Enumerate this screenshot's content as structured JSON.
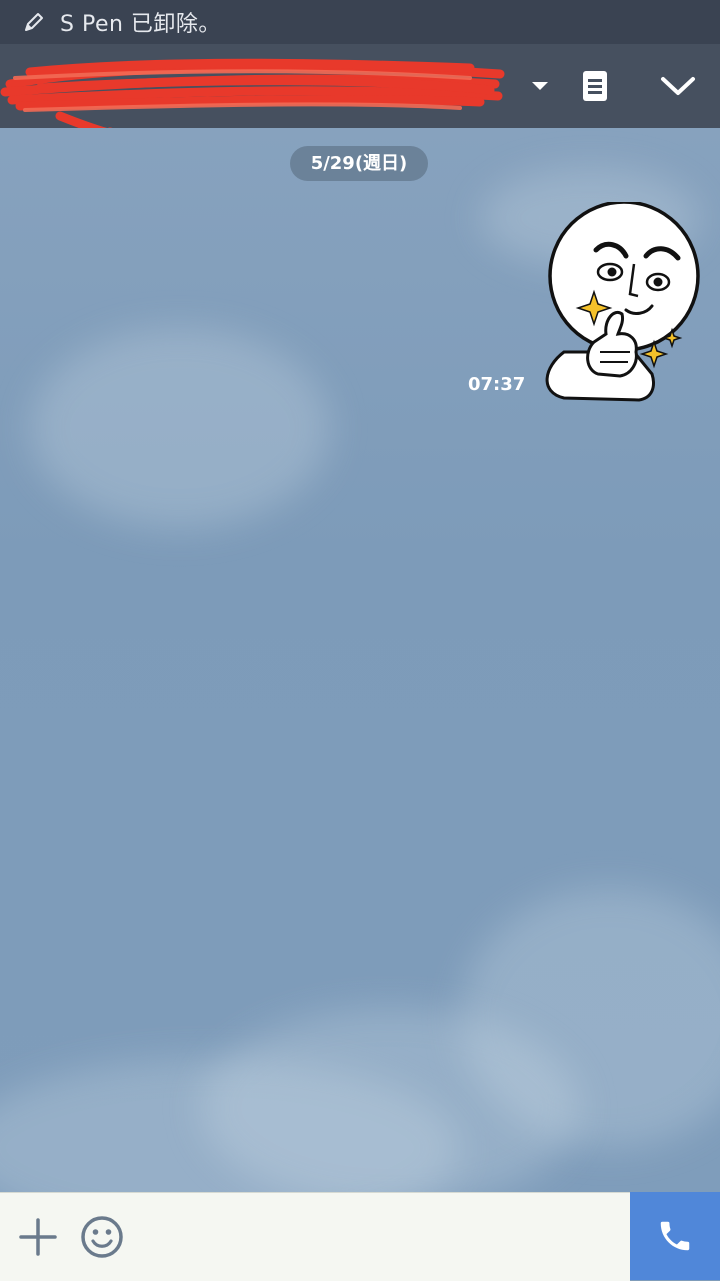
{
  "status_bar": {
    "notification_text": "S Pen 已卸除。",
    "icon": "pen-icon"
  },
  "header": {
    "title_redacted": true,
    "icons": [
      "dropdown-arrow-icon",
      "notes-icon",
      "chevron-down-icon"
    ]
  },
  "chat": {
    "date_label": "5/29(週日)",
    "messages": [
      {
        "type": "sticker",
        "sender": "self",
        "time": "07:37",
        "sticker": "thumbs-up-smirk-face"
      }
    ]
  },
  "input_bar": {
    "icons": [
      "plus-icon",
      "emoji-icon",
      "phone-icon"
    ]
  },
  "colors": {
    "status_bar": "#3a4352",
    "header": "#46505f",
    "chat_background": "#7f9cb9",
    "date_pill": "#6b8299",
    "call_button": "#5087d9",
    "redaction": "#e8392b"
  }
}
